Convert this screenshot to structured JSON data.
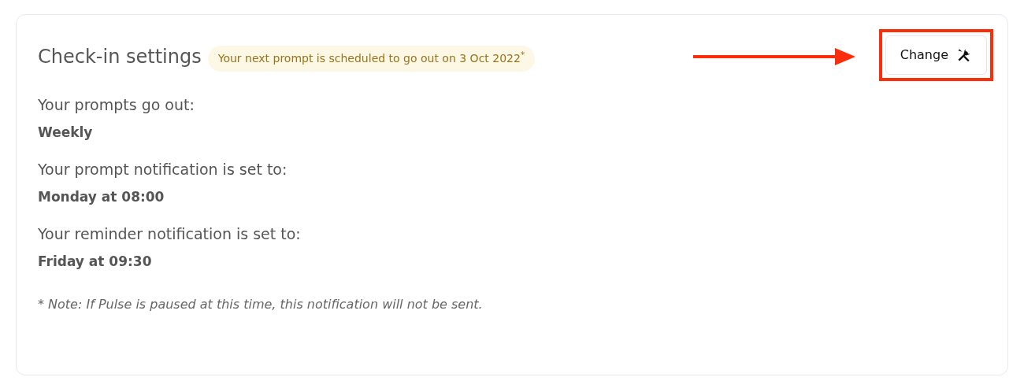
{
  "header": {
    "title": "Check-in settings",
    "badge": "Your next prompt is scheduled to go out on 3 Oct 2022$^{*}$",
    "button": "Change"
  },
  "settings": [
    {
      "label": "Your prompts go out:",
      "value": "Weekly"
    },
    {
      "label": "Your prompt notification is set to:",
      "value": "Monday at 08:00"
    },
    {
      "label": "Your reminder notification is set to:",
      "value": "Friday at 09:30"
    }
  ],
  "note": "* Note: If Pulse is paused at this time, this notification will not be sent."
}
